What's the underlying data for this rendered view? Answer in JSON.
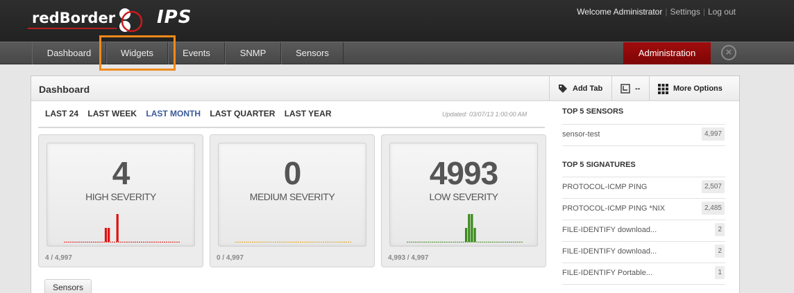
{
  "brand": {
    "name": "redBorder",
    "product": "IPS"
  },
  "user_links": {
    "welcome": "Welcome Administrator",
    "settings": "Settings",
    "logout": "Log out"
  },
  "nav": {
    "items": [
      "Dashboard",
      "Widgets",
      "Events",
      "SNMP",
      "Sensors"
    ],
    "admin": "Administration",
    "close_icon": "close-icon"
  },
  "panel": {
    "title": "Dashboard",
    "add_tab": "Add Tab",
    "refresh": "--",
    "more_options": "More Options"
  },
  "ranges": {
    "items": [
      "LAST 24",
      "LAST WEEK",
      "LAST MONTH",
      "LAST QUARTER",
      "LAST YEAR"
    ],
    "active": "LAST MONTH",
    "updated": "Updated: 03/07/13 1:00:00 AM"
  },
  "cards": [
    {
      "value": "4",
      "label": "HIGH SEVERITY",
      "footer": "4 / 4,997",
      "color": "#e01010",
      "bars": [
        0,
        0,
        0,
        0,
        0,
        0,
        0,
        0,
        0,
        0,
        0,
        0,
        0,
        0,
        1,
        1,
        0,
        0,
        2,
        0,
        0,
        0,
        0,
        0,
        0,
        0,
        0,
        0,
        0,
        0,
        0,
        0,
        0,
        0,
        0,
        0,
        0,
        0,
        0,
        0
      ]
    },
    {
      "value": "0",
      "label": "MEDIUM SEVERITY",
      "footer": "0 / 4,997",
      "color": "#e8a81c",
      "bars": [
        0,
        0,
        0,
        0,
        0,
        0,
        0,
        0,
        0,
        0,
        0,
        0,
        0,
        0,
        0,
        0,
        0,
        0,
        0,
        0,
        0,
        0,
        0,
        0,
        0,
        0,
        0,
        0,
        0,
        0,
        0,
        0,
        0,
        0,
        0,
        0,
        0,
        0,
        0,
        0
      ]
    },
    {
      "value": "4993",
      "label": "LOW SEVERITY",
      "footer": "4,993 / 4,997",
      "color": "#3a8a1a",
      "bars": [
        0,
        0,
        0,
        0,
        0,
        0,
        0,
        0,
        0,
        0,
        0,
        0,
        0,
        0,
        0,
        0,
        0,
        0,
        0,
        0,
        1,
        2,
        2,
        1,
        0,
        0,
        0,
        0,
        0,
        0,
        0,
        0,
        0,
        0,
        0,
        0,
        0,
        0,
        0,
        0
      ]
    }
  ],
  "tags": {
    "sensors": "Sensors"
  },
  "top_sensors": {
    "title": "TOP 5 SENSORS",
    "rows": [
      {
        "name": "sensor-test",
        "count": "4,997"
      }
    ]
  },
  "top_signatures": {
    "title": "TOP 5 SIGNATURES",
    "rows": [
      {
        "name": "PROTOCOL-ICMP PING",
        "count": "2,507"
      },
      {
        "name": "PROTOCOL-ICMP PING *NIX",
        "count": "2,485"
      },
      {
        "name": "FILE-IDENTIFY download...",
        "count": "2"
      },
      {
        "name": "FILE-IDENTIFY download...",
        "count": "2"
      },
      {
        "name": "FILE-IDENTIFY Portable...",
        "count": "1"
      }
    ]
  }
}
